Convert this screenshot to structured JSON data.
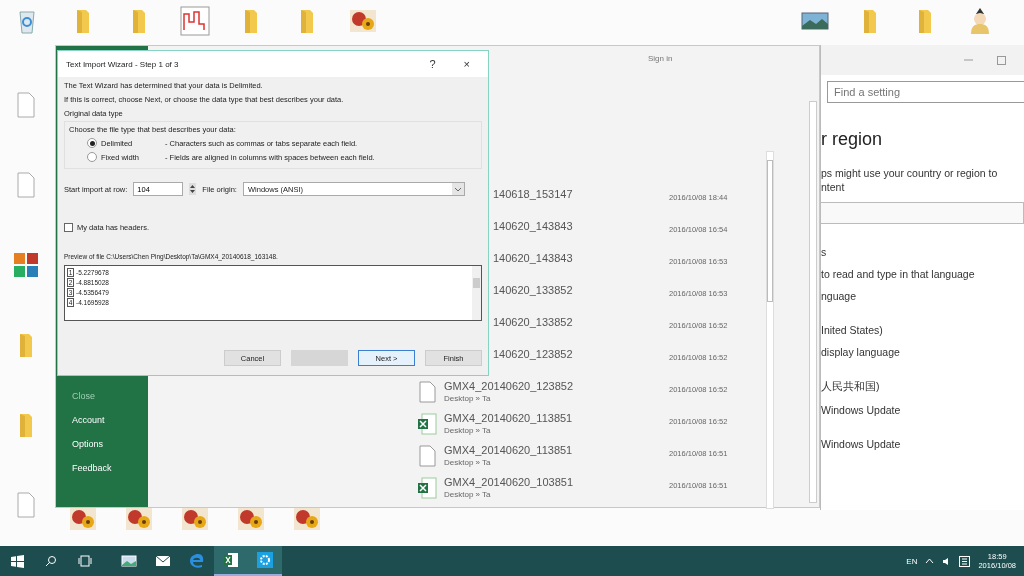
{
  "desktop": {
    "top_left_icons": [
      {
        "kind": "recycle"
      },
      {
        "kind": "folder"
      },
      {
        "kind": "folder"
      },
      {
        "kind": "chart"
      },
      {
        "kind": "folder"
      },
      {
        "kind": "folder"
      },
      {
        "kind": "flower"
      }
    ],
    "top_right_icons": [
      {
        "kind": "landscape"
      },
      {
        "kind": "folder"
      },
      {
        "kind": "folder"
      },
      {
        "kind": "character"
      }
    ],
    "left_icons": [
      {
        "kind": "document"
      },
      {
        "kind": "document"
      },
      {
        "kind": "mfc"
      },
      {
        "kind": "folder"
      },
      {
        "kind": "folder"
      },
      {
        "kind": "document"
      }
    ],
    "bottom_icons": [
      {
        "kind": "flower"
      },
      {
        "kind": "flower"
      },
      {
        "kind": "flower"
      },
      {
        "kind": "flower"
      },
      {
        "kind": "flower"
      }
    ]
  },
  "excel": {
    "sign_in": "Sign in",
    "backstage_items": [
      {
        "label": "Close",
        "disabled": true
      },
      {
        "label": "Account",
        "disabled": false
      },
      {
        "label": "Options",
        "disabled": false
      },
      {
        "label": "Feedback",
        "disabled": false
      }
    ],
    "files": [
      {
        "kind": "covered",
        "name": "140618_153147",
        "modified": "2016/10/08 18:44"
      },
      {
        "kind": "covered",
        "name": "140620_143843",
        "modified": "2016/10/08 16:54"
      },
      {
        "kind": "covered",
        "name": "140620_143843",
        "modified": "2016/10/08 16:53"
      },
      {
        "kind": "covered",
        "name": "140620_133852",
        "modified": "2016/10/08 16:53"
      },
      {
        "kind": "covered",
        "name": "140620_133852",
        "modified": "2016/10/08 16:52"
      },
      {
        "kind": "covered",
        "name": "140620_123852",
        "modified": "2016/10/08 16:52"
      },
      {
        "kind": "blank",
        "name": "GMX4_20140620_123852",
        "location": "Desktop » Ta",
        "modified": "2016/10/08 16:52"
      },
      {
        "kind": "excel",
        "name": "GMX4_20140620_113851",
        "location": "Desktop » Ta",
        "modified": "2016/10/08 16:52"
      },
      {
        "kind": "blank",
        "name": "GMX4_20140620_113851",
        "location": "Desktop » Ta",
        "modified": "2016/10/08 16:51"
      },
      {
        "kind": "excel",
        "name": "GMX4_20140620_103851",
        "location": "Desktop » Ta",
        "modified": "2016/10/08 16:51"
      }
    ]
  },
  "dialog": {
    "title": "Text Import Wizard - Step 1 of 3",
    "help": "?",
    "close": "×",
    "intro": "The Text Wizard has determined that your data is Delimited.",
    "instruction": "If this is correct, choose Next, or choose the data type that best describes your data.",
    "group_title": "Original data type",
    "group_prompt": "Choose the file type that best describes your data:",
    "file_types": [
      {
        "label": "Delimited",
        "description": "- Characters such as commas or tabs separate each field.",
        "selected": true
      },
      {
        "label": "Fixed width",
        "description": "- Fields are aligned in columns with spaces between each field.",
        "selected": false
      }
    ],
    "start_row_label": "Start import at row:",
    "start_row": "104",
    "origin_label": "File origin:",
    "origin": "Windows (ANSI)",
    "headers": {
      "label": "My data has headers.",
      "checked": false
    },
    "preview_label": "Preview of file C:\\Users\\Chen Ping\\Desktop\\Ta\\GMX4_20140618_163148.",
    "preview_lines": [
      {
        "number": "1",
        "value": "-5.2279678"
      },
      {
        "number": "2",
        "value": "-4.8815028"
      },
      {
        "number": "3",
        "value": "-4.5356479"
      },
      {
        "number": "4",
        "value": "-4.1695928"
      }
    ],
    "buttons": [
      {
        "kind": "normal",
        "label": "Cancel"
      },
      {
        "kind": "disabled"
      },
      {
        "kind": "default",
        "label": "Next >"
      },
      {
        "kind": "normal",
        "label": "Finish"
      }
    ]
  },
  "settings": {
    "search_placeholder": "Find a setting",
    "heading": "r region",
    "description": [
      "ps might use your country or region to",
      "ntent"
    ],
    "lines": [
      {
        "kind": "gap",
        "text": "s"
      },
      {
        "kind": "line",
        "text": "to read and type in that language"
      },
      {
        "kind": "line",
        "text": "nguage"
      },
      {
        "kind": "gap",
        "text": "Inited States)"
      },
      {
        "kind": "line",
        "text": "display language"
      },
      {
        "kind": "gap",
        "text": "人民共和国)"
      },
      {
        "kind": "line",
        "text": "Windows Update"
      },
      {
        "kind": "gap",
        "text": "Windows Update"
      }
    ]
  },
  "taskbar": {
    "apps": [
      {
        "kind": "photos",
        "active": false
      },
      {
        "kind": "mail",
        "active": false
      },
      {
        "kind": "browser",
        "active": false
      },
      {
        "kind": "excel",
        "active": true
      },
      {
        "kind": "settings",
        "active": true
      }
    ],
    "language": "EN",
    "time": "18:59",
    "date": "2016/10/08"
  }
}
